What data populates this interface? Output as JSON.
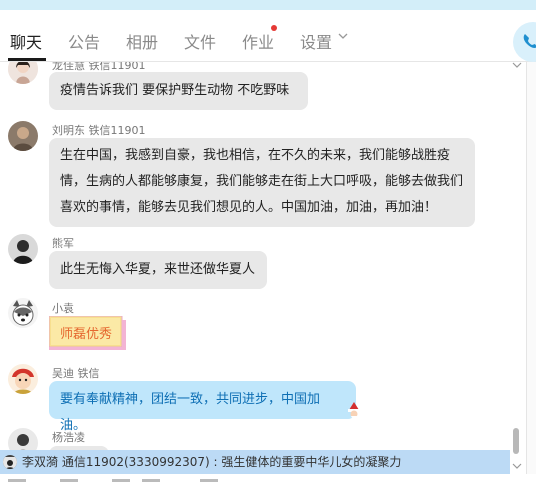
{
  "tabs": [
    {
      "label": "聊天",
      "active": true
    },
    {
      "label": "公告"
    },
    {
      "label": "相册"
    },
    {
      "label": "文件"
    },
    {
      "label": "作业",
      "has_notification": true
    },
    {
      "label": "设置"
    }
  ],
  "messages": [
    {
      "sender": "龙佳慧  铁信11901",
      "text": "疫情告诉我们 要保护野生动物 不吃野味",
      "avatar": "woman-avatar"
    },
    {
      "sender": "刘明东 铁信11901",
      "lines": [
        "生在中国，我感到自豪，我也相信，在不久的未来，我们能够战胜疫",
        "情，生病的人都能够康复，我们能够走在街上大口呼吸，能够去做我们",
        "喜欢的事情，能够去见我们想见的人。中国加油，加油，再加油！"
      ],
      "avatar": "man-avatar"
    },
    {
      "sender": "熊军",
      "text": "此生无悔入华夏，来世还做华夏人",
      "avatar": "dark-avatar"
    },
    {
      "sender": "小袁",
      "sticker_text": "师磊优秀",
      "avatar": "husky-avatar"
    },
    {
      "sender": "吴迪  铁信",
      "text": "要有奉献精神，团结一致，共同进步，中国加油。",
      "avatar": "cartoon-avatar"
    },
    {
      "sender": "杨浩凌",
      "avatar": "portrait-avatar"
    }
  ],
  "ticker": {
    "text": "李双漪  通信11902(3330992307)  :  强生健体的重要中华儿女的凝聚力"
  },
  "colors": {
    "bubble_gray": "#e8e8e8",
    "bubble_blue": "#bfe6fb",
    "blue_text": "#0e6fb4",
    "ticker_bg": "#bcdaf5",
    "notification": "#e53935"
  }
}
